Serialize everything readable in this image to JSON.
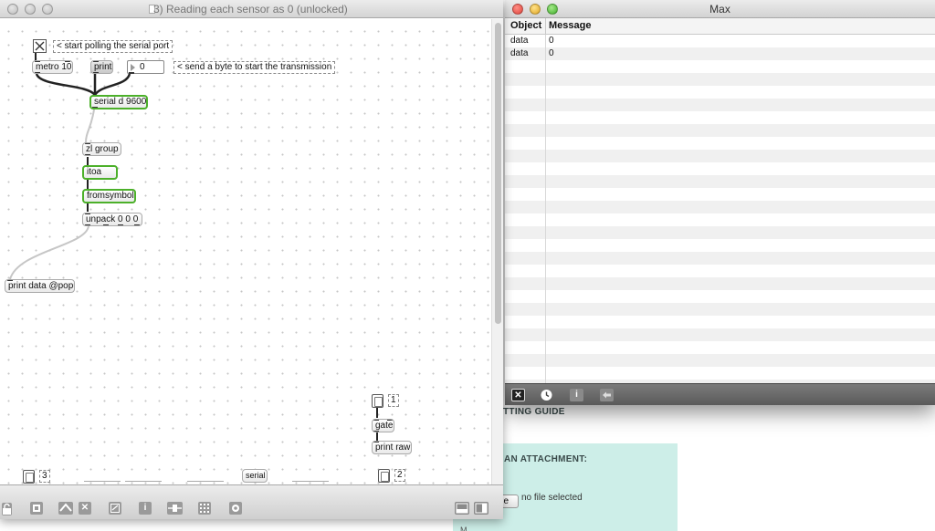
{
  "background_page": {
    "heading_1": "TTING GUIDE",
    "heading_2": "AN ATTACHMENT:",
    "choose_label": "ile",
    "no_file_text": "no file selected",
    "cut_text": "M"
  },
  "max_window": {
    "title": "Max",
    "columns": [
      "Object",
      "Message"
    ],
    "rows": [
      {
        "object": "data",
        "message": "0"
      },
      {
        "object": "data",
        "message": "0"
      }
    ],
    "toolbar_icons": [
      "clear-icon",
      "clock-icon",
      "info-icon",
      "back-arrow-icon"
    ]
  },
  "patcher_window": {
    "title": "3) Reading each sensor as 0 (unlocked)",
    "objects": {
      "metro": "metro 10",
      "print_msg": "print",
      "number": "0",
      "serial": "serial d 9600",
      "zl": "zl group",
      "itoa": "itoa",
      "fromsymbol": "fromsymbol",
      "unpack": "unpack 0 0 0",
      "print_data": "print data @popup",
      "gate": "gate",
      "print_raw": "print raw",
      "serial_small": "serial"
    },
    "comments": {
      "start_polling": "< start polling the serial port",
      "send_byte": "< send a byte to start the transmission"
    },
    "toggle_labels": {
      "one": "1",
      "two": "2",
      "three": "3"
    },
    "toolbar_icons": [
      "lock-icon",
      "presentation-icon",
      "bpatcher-icon",
      "clear-icon",
      "window-icon",
      "inspector-icon",
      "slider-icon",
      "grid-icon",
      "debug-icon",
      "left-pane-icon",
      "right-pane-icon"
    ]
  },
  "colors": {
    "active_object_border": "#4cb02a",
    "max_toolbar": "#666666",
    "background_panel": "#cdeee8"
  }
}
